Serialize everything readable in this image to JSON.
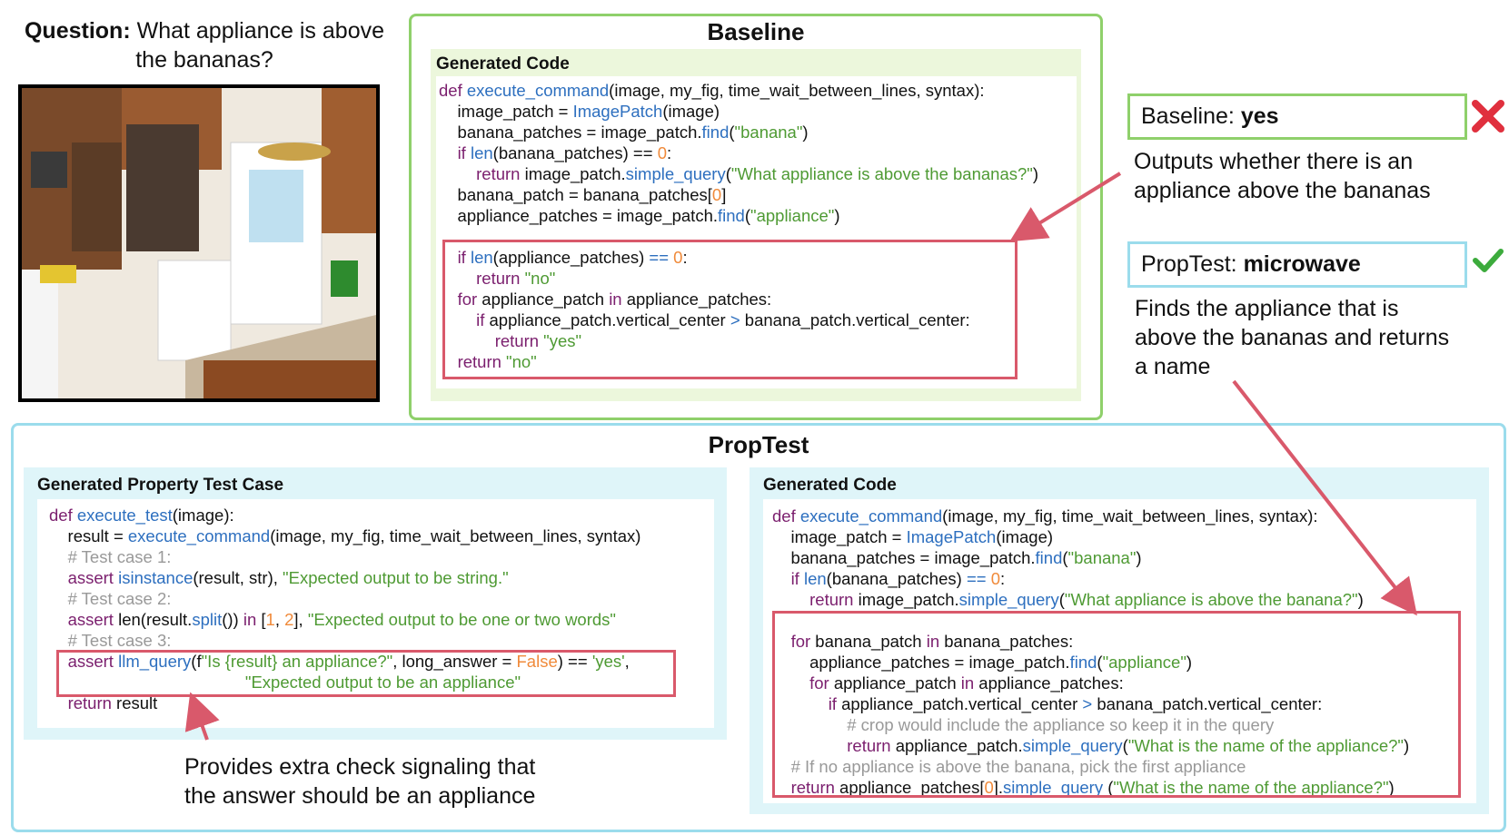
{
  "question": {
    "label": "Question:",
    "text": "What appliance is above the bananas?"
  },
  "baseline": {
    "title": "Baseline",
    "code_heading": "Generated Code",
    "answer_label": "Baseline:",
    "answer_value": "yes",
    "answer_desc_1": "Outputs whether there is an",
    "answer_desc_2": "appliance above the bananas"
  },
  "proptest": {
    "title": "PropTest",
    "test_heading": "Generated Property Test Case",
    "code_heading": "Generated Code",
    "answer_label": "PropTest:",
    "answer_value": "microwave",
    "answer_desc_1": "Finds the appliance that is",
    "answer_desc_2": "above the bananas and returns",
    "answer_desc_3": "a name",
    "note_1": "Provides extra check signaling that",
    "note_2": "the answer should be an appliance"
  },
  "colors": {
    "baseline_border": "#8fd06b",
    "proptest_border": "#9bdcec",
    "highlight": "#d9596b",
    "wrong": "#e0303e",
    "right": "#3cab3c"
  },
  "icons": {
    "wrong": "cross-icon",
    "right": "check-icon"
  }
}
